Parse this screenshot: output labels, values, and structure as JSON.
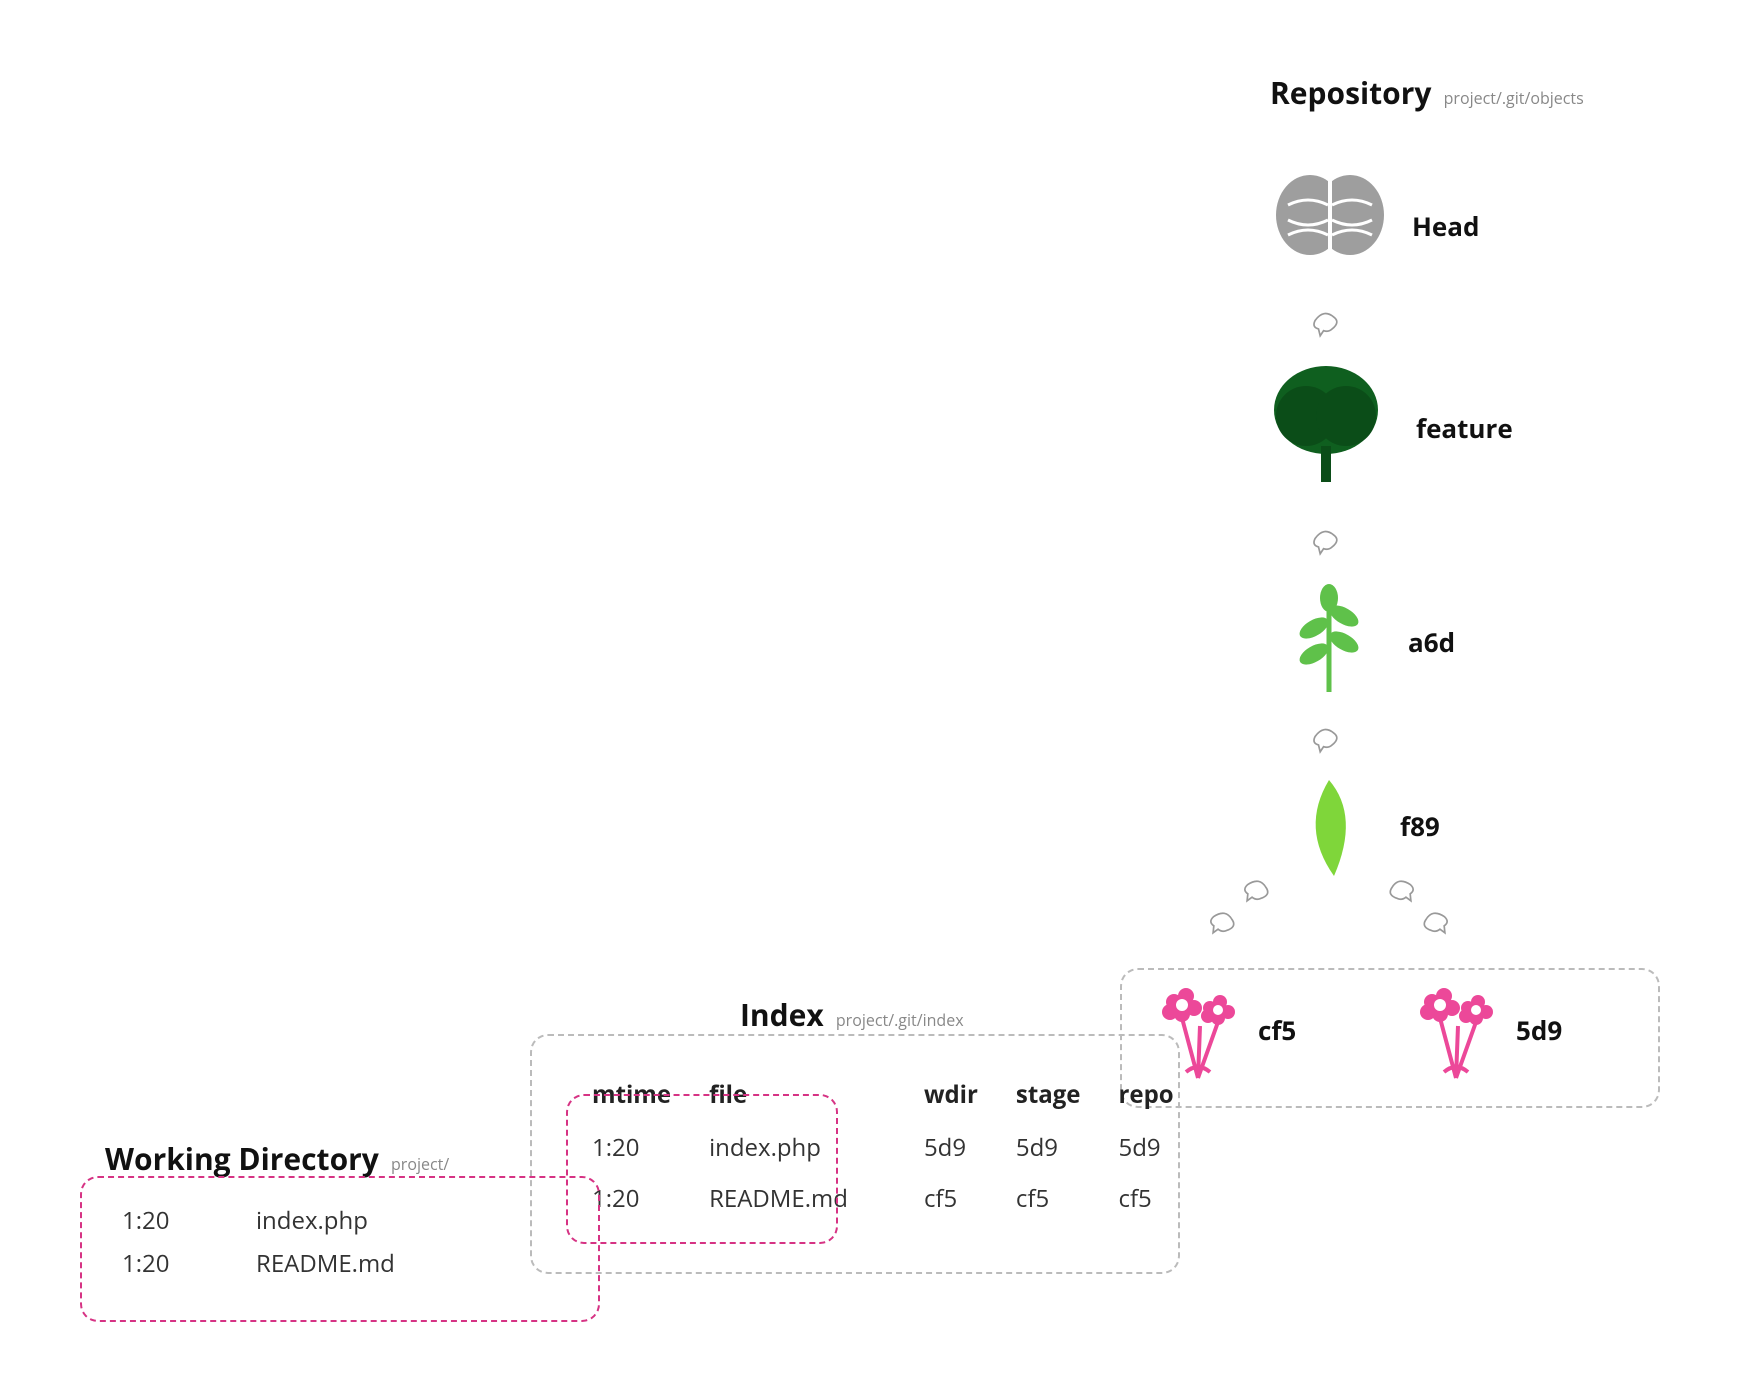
{
  "repository": {
    "title": "Repository",
    "path": "project/.git/objects",
    "head_label": "Head",
    "feature_label": "feature",
    "commit_label": "a6d",
    "tree_label": "f89",
    "blob_left_label": "cf5",
    "blob_right_label": "5d9"
  },
  "index": {
    "title": "Index",
    "path": "project/.git/index",
    "headers": {
      "mtime": "mtime",
      "file": "file",
      "wdir": "wdir",
      "stage": "stage",
      "repo": "repo"
    },
    "rows": [
      {
        "mtime": "1:20",
        "file": "index.php",
        "wdir": "5d9",
        "stage": "5d9",
        "repo": "5d9"
      },
      {
        "mtime": "1:20",
        "file": "README.md",
        "wdir": "cf5",
        "stage": "cf5",
        "repo": "cf5"
      }
    ]
  },
  "working_directory": {
    "title": "Working Directory",
    "path": "project/",
    "rows": [
      {
        "mtime": "1:20",
        "file": "index.php"
      },
      {
        "mtime": "1:20",
        "file": "README.md"
      }
    ]
  }
}
